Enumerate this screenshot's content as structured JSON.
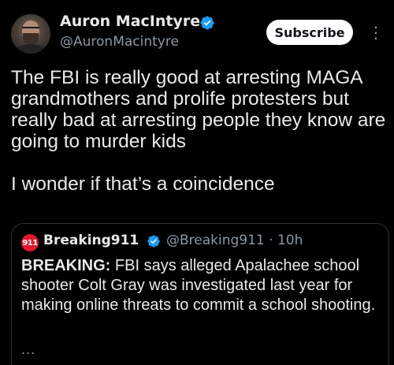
{
  "author": {
    "display_name": "Auron MacIntyre",
    "handle": "@AuronMacintyre",
    "verified_icon": "verified-badge-icon"
  },
  "actions": {
    "subscribe_label": "Subscribe",
    "more_label": "⋮"
  },
  "post": {
    "paragraphs": [
      "The FBI is really good at arresting MAGA grandmothers and prolife protesters but really bad at arresting people they know are going to murder kids",
      "I wonder if that’s a coincidence"
    ]
  },
  "quoted_post": {
    "logo_text": "911",
    "display_name": "Breaking911",
    "handle": "@Breaking911",
    "separator": "·",
    "time": "10h",
    "lead": "BREAKING:",
    "text": " FBI says alleged Apalachee school shooter Colt Gray was investigated last year for making online threats to commit a school shooting.",
    "truncation": "..."
  },
  "colors": {
    "background": "#000000",
    "text_primary": "#e7e9ea",
    "text_secondary": "#8b98a5",
    "verified_blue": "#1d9bf0",
    "subscribe_bg": "#ffffff",
    "logo_red": "#e0182d",
    "border": "#2f3336"
  }
}
